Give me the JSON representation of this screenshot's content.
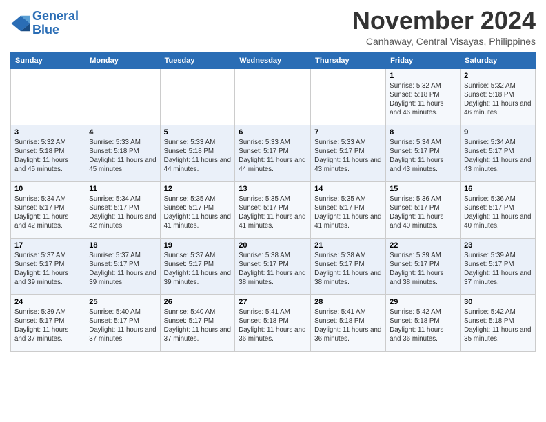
{
  "logo": {
    "line1": "General",
    "line2": "Blue"
  },
  "title": "November 2024",
  "subtitle": "Canhaway, Central Visayas, Philippines",
  "days_of_week": [
    "Sunday",
    "Monday",
    "Tuesday",
    "Wednesday",
    "Thursday",
    "Friday",
    "Saturday"
  ],
  "weeks": [
    [
      {
        "day": "",
        "info": ""
      },
      {
        "day": "",
        "info": ""
      },
      {
        "day": "",
        "info": ""
      },
      {
        "day": "",
        "info": ""
      },
      {
        "day": "",
        "info": ""
      },
      {
        "day": "1",
        "info": "Sunrise: 5:32 AM\nSunset: 5:18 PM\nDaylight: 11 hours and 46 minutes."
      },
      {
        "day": "2",
        "info": "Sunrise: 5:32 AM\nSunset: 5:18 PM\nDaylight: 11 hours and 46 minutes."
      }
    ],
    [
      {
        "day": "3",
        "info": "Sunrise: 5:32 AM\nSunset: 5:18 PM\nDaylight: 11 hours and 45 minutes."
      },
      {
        "day": "4",
        "info": "Sunrise: 5:33 AM\nSunset: 5:18 PM\nDaylight: 11 hours and 45 minutes."
      },
      {
        "day": "5",
        "info": "Sunrise: 5:33 AM\nSunset: 5:18 PM\nDaylight: 11 hours and 44 minutes."
      },
      {
        "day": "6",
        "info": "Sunrise: 5:33 AM\nSunset: 5:17 PM\nDaylight: 11 hours and 44 minutes."
      },
      {
        "day": "7",
        "info": "Sunrise: 5:33 AM\nSunset: 5:17 PM\nDaylight: 11 hours and 43 minutes."
      },
      {
        "day": "8",
        "info": "Sunrise: 5:34 AM\nSunset: 5:17 PM\nDaylight: 11 hours and 43 minutes."
      },
      {
        "day": "9",
        "info": "Sunrise: 5:34 AM\nSunset: 5:17 PM\nDaylight: 11 hours and 43 minutes."
      }
    ],
    [
      {
        "day": "10",
        "info": "Sunrise: 5:34 AM\nSunset: 5:17 PM\nDaylight: 11 hours and 42 minutes."
      },
      {
        "day": "11",
        "info": "Sunrise: 5:34 AM\nSunset: 5:17 PM\nDaylight: 11 hours and 42 minutes."
      },
      {
        "day": "12",
        "info": "Sunrise: 5:35 AM\nSunset: 5:17 PM\nDaylight: 11 hours and 41 minutes."
      },
      {
        "day": "13",
        "info": "Sunrise: 5:35 AM\nSunset: 5:17 PM\nDaylight: 11 hours and 41 minutes."
      },
      {
        "day": "14",
        "info": "Sunrise: 5:35 AM\nSunset: 5:17 PM\nDaylight: 11 hours and 41 minutes."
      },
      {
        "day": "15",
        "info": "Sunrise: 5:36 AM\nSunset: 5:17 PM\nDaylight: 11 hours and 40 minutes."
      },
      {
        "day": "16",
        "info": "Sunrise: 5:36 AM\nSunset: 5:17 PM\nDaylight: 11 hours and 40 minutes."
      }
    ],
    [
      {
        "day": "17",
        "info": "Sunrise: 5:37 AM\nSunset: 5:17 PM\nDaylight: 11 hours and 39 minutes."
      },
      {
        "day": "18",
        "info": "Sunrise: 5:37 AM\nSunset: 5:17 PM\nDaylight: 11 hours and 39 minutes."
      },
      {
        "day": "19",
        "info": "Sunrise: 5:37 AM\nSunset: 5:17 PM\nDaylight: 11 hours and 39 minutes."
      },
      {
        "day": "20",
        "info": "Sunrise: 5:38 AM\nSunset: 5:17 PM\nDaylight: 11 hours and 38 minutes."
      },
      {
        "day": "21",
        "info": "Sunrise: 5:38 AM\nSunset: 5:17 PM\nDaylight: 11 hours and 38 minutes."
      },
      {
        "day": "22",
        "info": "Sunrise: 5:39 AM\nSunset: 5:17 PM\nDaylight: 11 hours and 38 minutes."
      },
      {
        "day": "23",
        "info": "Sunrise: 5:39 AM\nSunset: 5:17 PM\nDaylight: 11 hours and 37 minutes."
      }
    ],
    [
      {
        "day": "24",
        "info": "Sunrise: 5:39 AM\nSunset: 5:17 PM\nDaylight: 11 hours and 37 minutes."
      },
      {
        "day": "25",
        "info": "Sunrise: 5:40 AM\nSunset: 5:17 PM\nDaylight: 11 hours and 37 minutes."
      },
      {
        "day": "26",
        "info": "Sunrise: 5:40 AM\nSunset: 5:17 PM\nDaylight: 11 hours and 37 minutes."
      },
      {
        "day": "27",
        "info": "Sunrise: 5:41 AM\nSunset: 5:18 PM\nDaylight: 11 hours and 36 minutes."
      },
      {
        "day": "28",
        "info": "Sunrise: 5:41 AM\nSunset: 5:18 PM\nDaylight: 11 hours and 36 minutes."
      },
      {
        "day": "29",
        "info": "Sunrise: 5:42 AM\nSunset: 5:18 PM\nDaylight: 11 hours and 36 minutes."
      },
      {
        "day": "30",
        "info": "Sunrise: 5:42 AM\nSunset: 5:18 PM\nDaylight: 11 hours and 35 minutes."
      }
    ]
  ]
}
